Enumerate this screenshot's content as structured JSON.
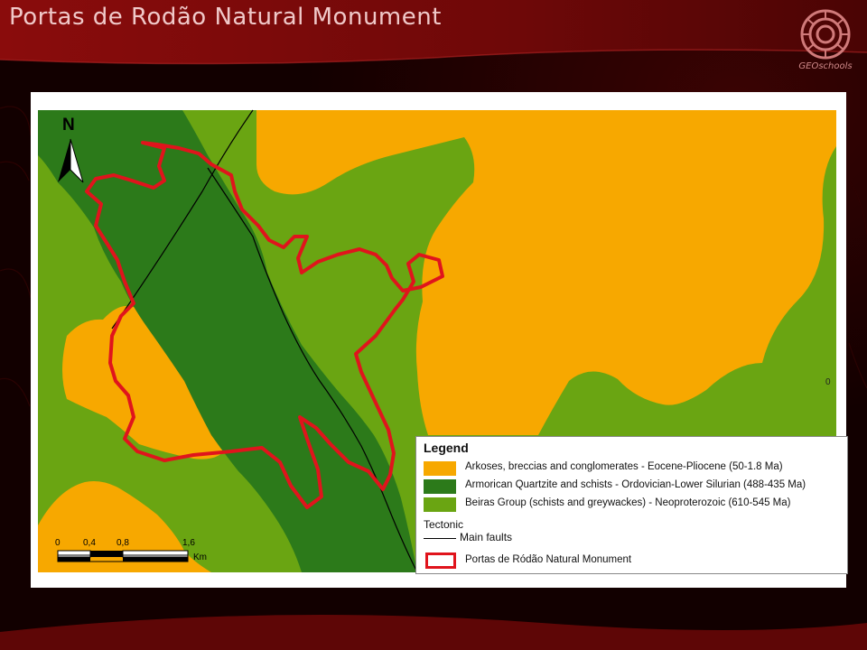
{
  "slide": {
    "title": "Portas de Rodão Natural Monument",
    "brand": "GEOschools"
  },
  "colors": {
    "slide_background": "#120000",
    "title_band": "#7a0a0a",
    "arkoses": "#f7a800",
    "quartzite": "#2c7a1a",
    "beiras": "#6aa512",
    "monument_outline": "#e0141c",
    "fault_line": "#000000"
  },
  "map": {
    "north_arrow": {
      "letter": "N",
      "icon": "north-arrow-icon"
    },
    "scale_bar": {
      "ticks": [
        "0",
        "0,4",
        "0,8",
        "1,6"
      ],
      "unit": "Km"
    },
    "edge_mark": "0",
    "legend": {
      "title": "Legend",
      "units": [
        {
          "label": "Arkoses, breccias and conglomerates - Eocene-Pliocene (50-1.8 Ma)",
          "color": "#f7a800"
        },
        {
          "label": "Armorican Quartzite and schists - Ordovician-Lower Silurian (488-435 Ma)",
          "color": "#2c7a1a"
        },
        {
          "label": "Beiras Group (schists and greywackes) - Neoproterozoic (610-545 Ma)",
          "color": "#6aa512"
        }
      ],
      "tectonic_heading": "Tectonic",
      "main_faults_label": "Main faults",
      "monument_label": "Portas de Ródão Natural Monument"
    }
  }
}
